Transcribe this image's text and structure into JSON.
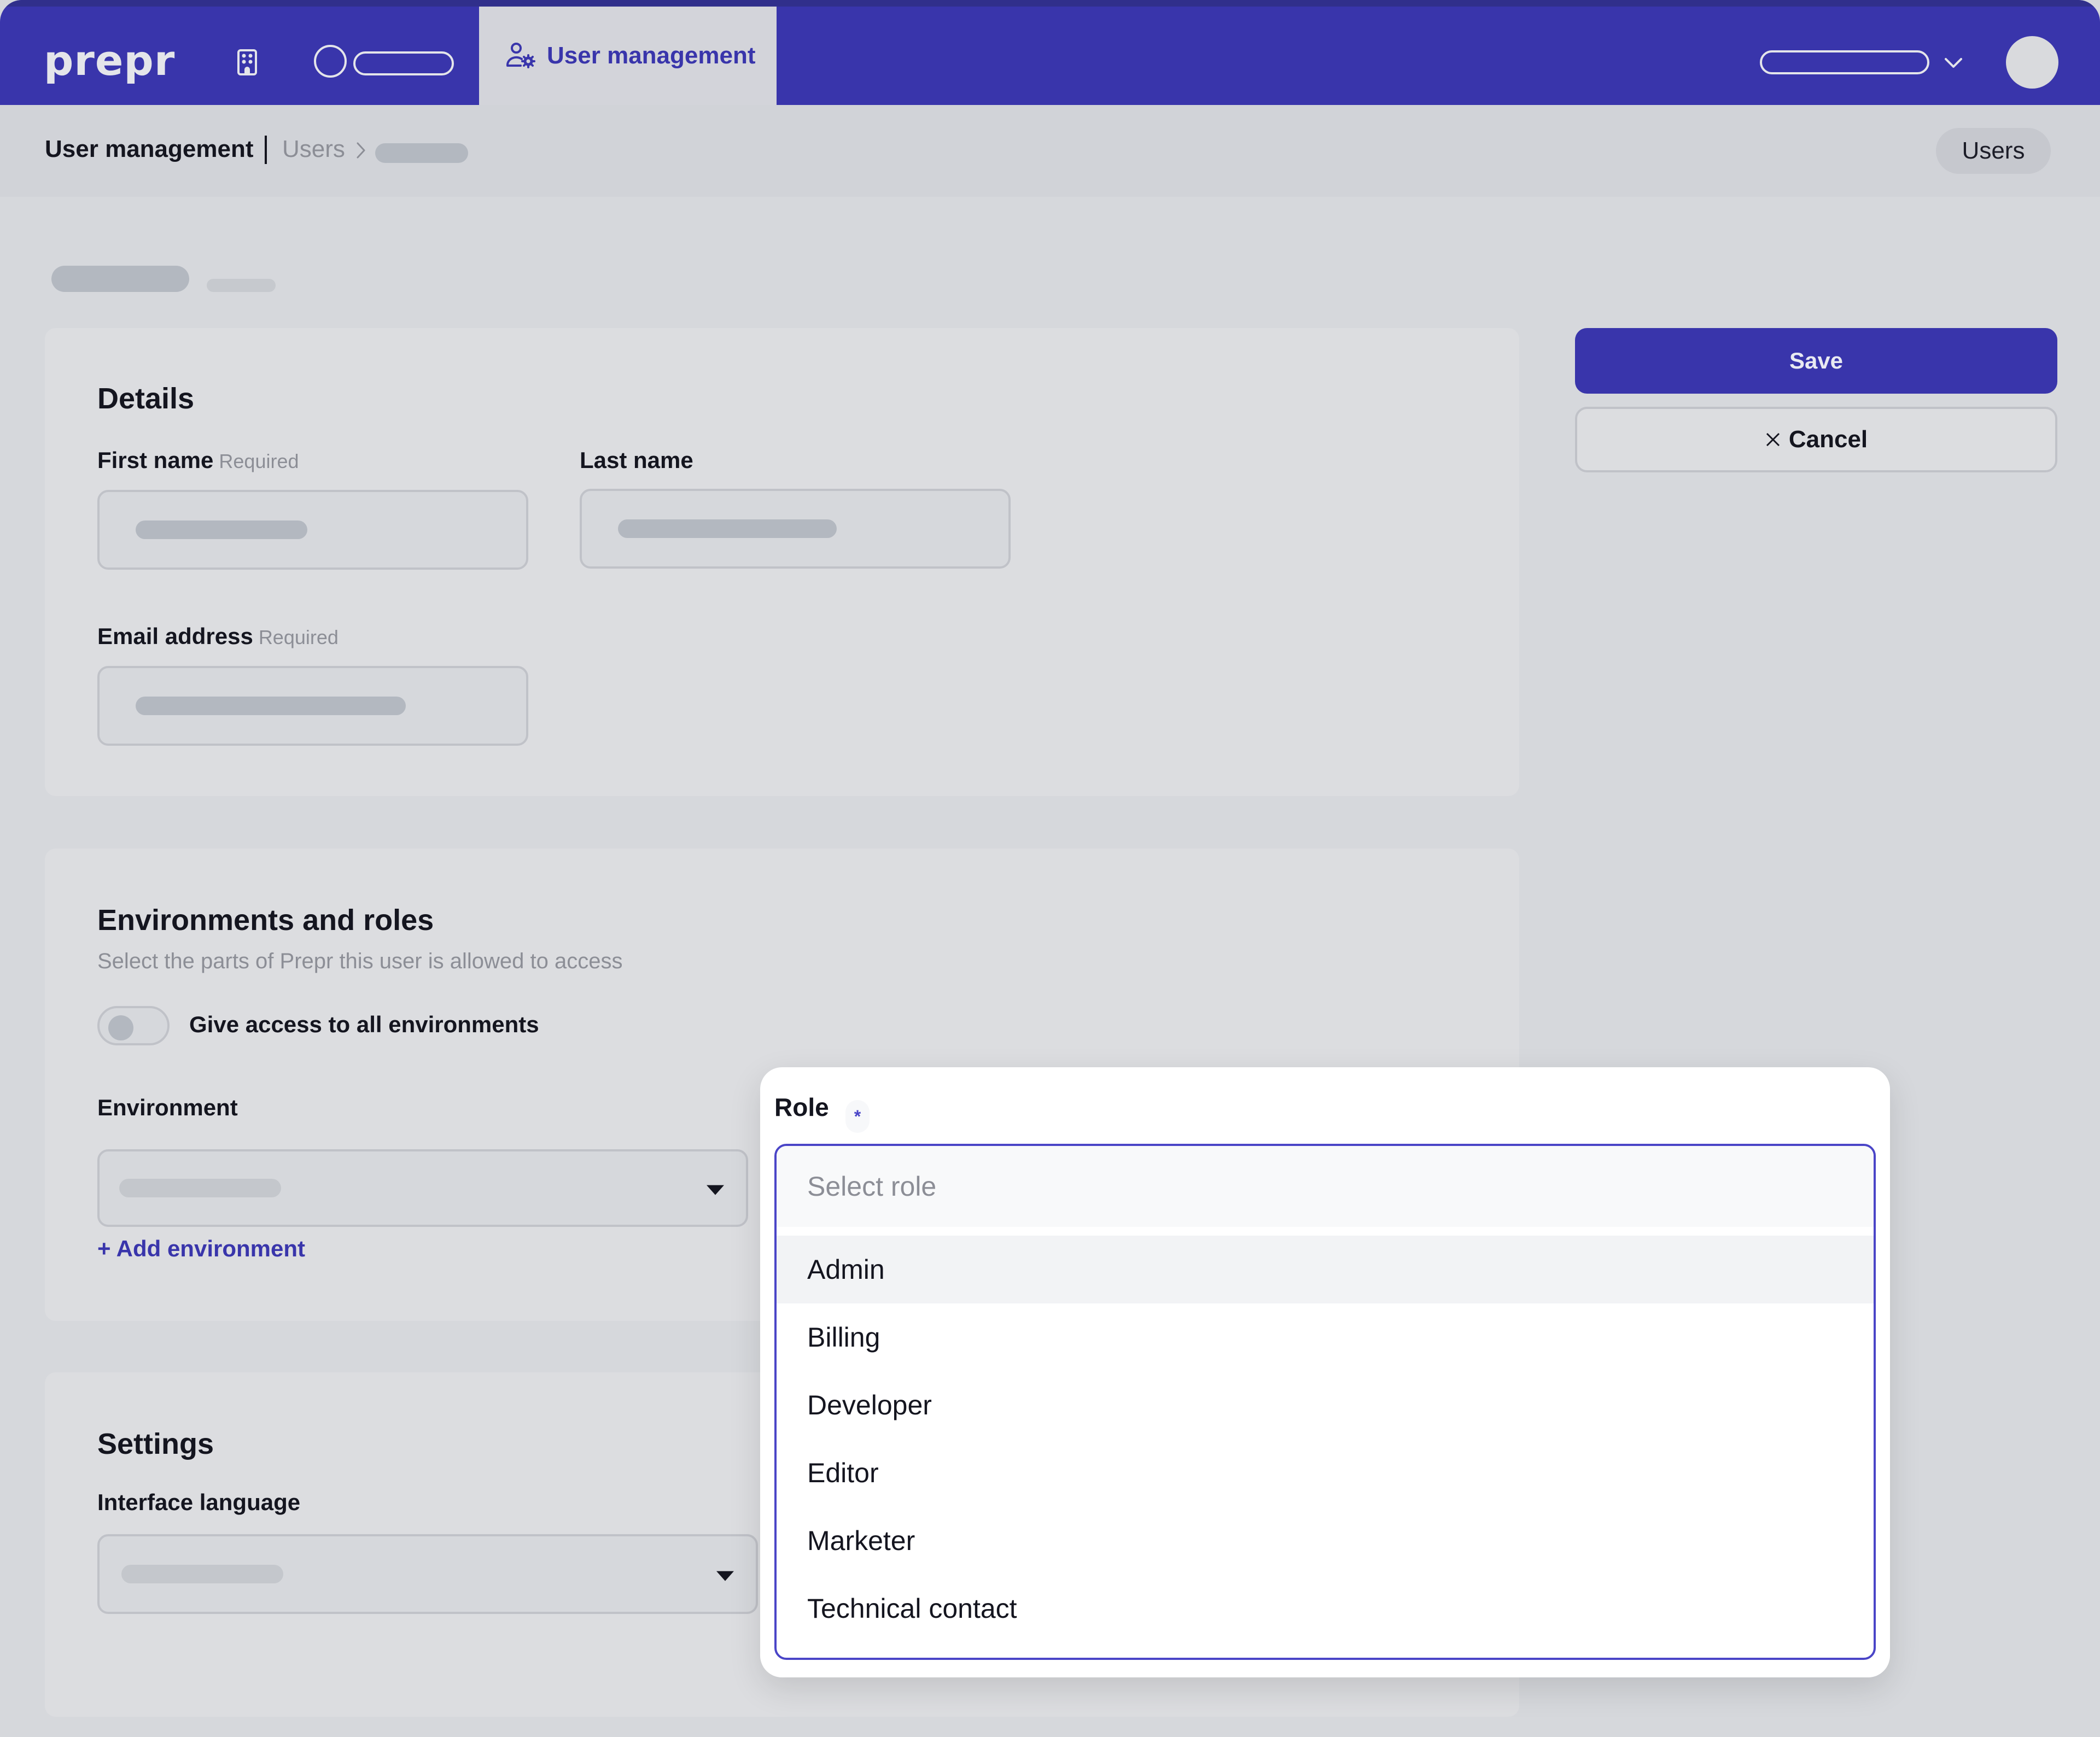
{
  "app": {
    "logo": "prepr",
    "brand_color": "#3935ab"
  },
  "topbar": {
    "org_icon": "building-icon",
    "environment_icon": "circle-icon",
    "active_tab": {
      "label": "User management",
      "icon": "user-gear-icon"
    },
    "org_switcher_icon": "chevron-down-icon",
    "avatar_icon": "avatar"
  },
  "breadcrumb": {
    "section": "User management",
    "parent": "Users",
    "separator_icon": "chevron-right-icon",
    "right_chip": "Users"
  },
  "actions": {
    "save_label": "Save",
    "cancel_label": "Cancel",
    "cancel_icon": "close-icon"
  },
  "details": {
    "title": "Details",
    "first_name": {
      "label": "First name",
      "hint": "Required",
      "value": ""
    },
    "last_name": {
      "label": "Last name",
      "value": ""
    },
    "email": {
      "label": "Email address",
      "hint": "Required",
      "value": ""
    }
  },
  "environments": {
    "title": "Environments and roles",
    "description": "Select the parts of Prepr this user is allowed to access",
    "toggle_label": "Give access to all environments",
    "toggle_on": false,
    "environment_label": "Environment",
    "add_environment": "+ Add environment"
  },
  "role": {
    "label": "Role",
    "required_marker": "*",
    "placeholder": "Select role",
    "options": [
      "Admin",
      "Billing",
      "Developer",
      "Editor",
      "Marketer",
      "Technical contact"
    ],
    "highlighted": "Admin"
  },
  "settings": {
    "title": "Settings",
    "language_label": "Interface language"
  }
}
